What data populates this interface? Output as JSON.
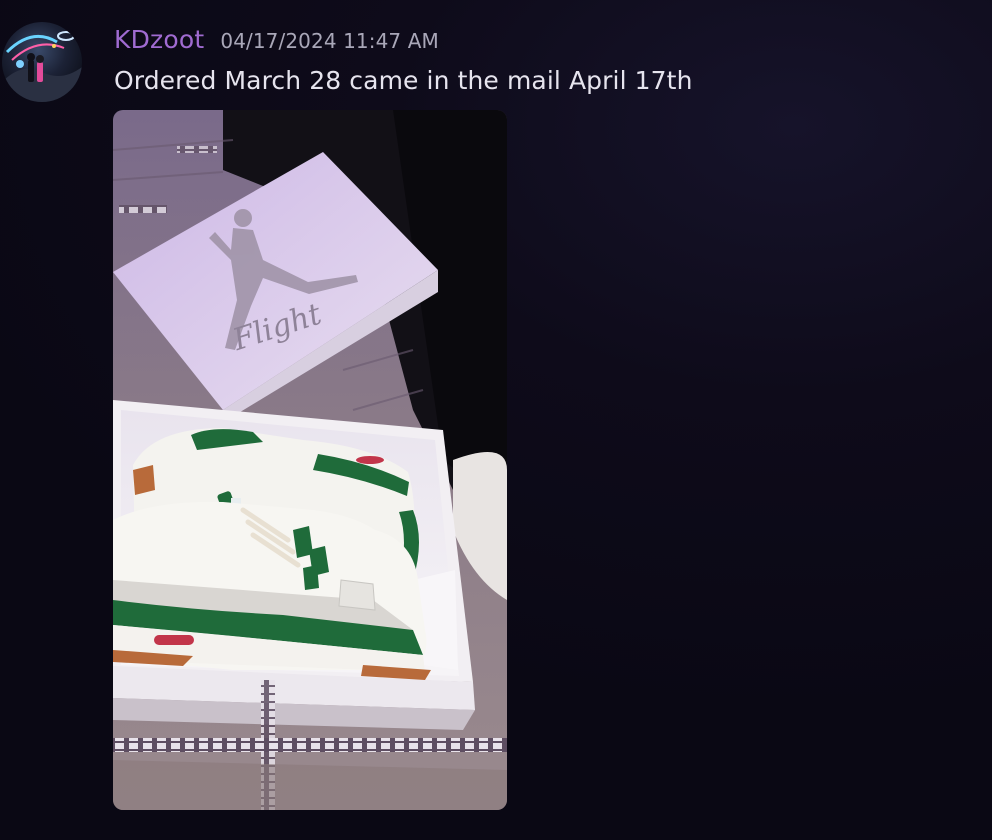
{
  "message": {
    "author": "KDzoot",
    "timestamp": "04/17/2024 11:47 AM",
    "content": "Ordered March 28 came in the mail April 17th",
    "avatar_icon": "user-avatar-icon",
    "attachment": {
      "box_lid_text": "Flight",
      "logo": "jumpman-logo"
    }
  },
  "colors": {
    "username": "#a06bd1",
    "timestamp": "#a9a7b8",
    "content": "#e6e4ee",
    "background": "#0c0a16",
    "shoe_green": "#1f6b3a"
  }
}
